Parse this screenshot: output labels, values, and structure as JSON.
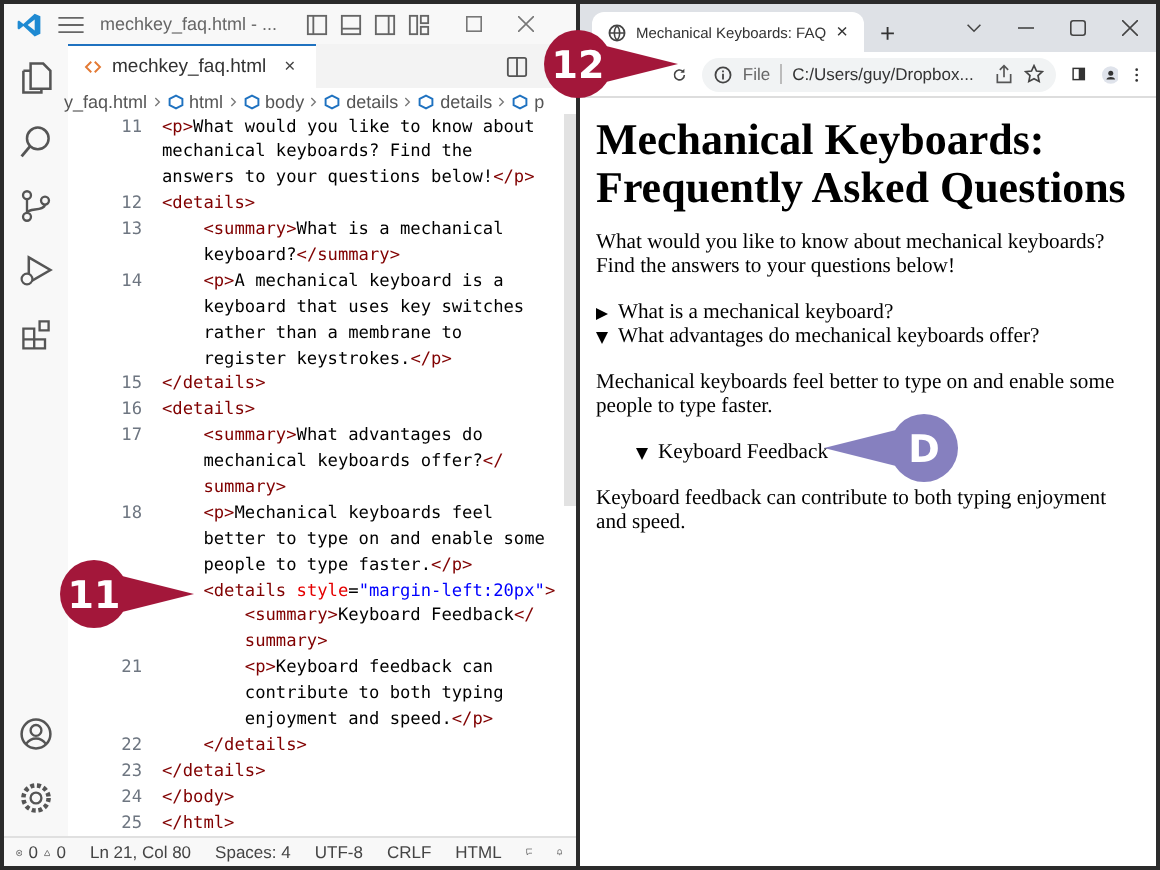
{
  "editor": {
    "title": "mechkey_faq.html - ...",
    "tab": {
      "label": "mechkey_faq.html",
      "close": "×"
    },
    "breadcrumbs": [
      "y_faq.html",
      "html",
      "body",
      "details",
      "details",
      "p"
    ],
    "rows": [
      {
        "number": "11",
        "segments": [
          {
            "kind": "tag",
            "text": "<p>"
          },
          {
            "kind": "text",
            "text": "What would you like to know about"
          }
        ]
      },
      {
        "segments": [
          {
            "kind": "text",
            "text": "mechanical keyboards? Find the"
          }
        ]
      },
      {
        "segments": [
          {
            "kind": "text",
            "text": "answers to your questions below!"
          },
          {
            "kind": "tag",
            "text": "</p>"
          }
        ]
      },
      {
        "number": "12",
        "segments": [
          {
            "kind": "tag",
            "text": "<details>"
          }
        ]
      },
      {
        "number": "13",
        "segments": [
          {
            "kind": "tag",
            "text": "    <summary>"
          },
          {
            "kind": "text",
            "text": "What is a mechanical"
          }
        ]
      },
      {
        "segments": [
          {
            "kind": "text",
            "text": "    keyboard?"
          },
          {
            "kind": "tag",
            "text": "</summary>"
          }
        ]
      },
      {
        "number": "14",
        "segments": [
          {
            "kind": "tag",
            "text": "    <p>"
          },
          {
            "kind": "text",
            "text": "A mechanical keyboard is a"
          }
        ]
      },
      {
        "segments": [
          {
            "kind": "text",
            "text": "    keyboard that uses key switches"
          }
        ]
      },
      {
        "segments": [
          {
            "kind": "text",
            "text": "    rather than a membrane to"
          }
        ]
      },
      {
        "segments": [
          {
            "kind": "text",
            "text": "    register keystrokes."
          },
          {
            "kind": "tag",
            "text": "</p>"
          }
        ]
      },
      {
        "number": "15",
        "segments": [
          {
            "kind": "tag",
            "text": "</details>"
          }
        ]
      },
      {
        "number": "16",
        "segments": [
          {
            "kind": "tag",
            "text": "<details>"
          }
        ]
      },
      {
        "number": "17",
        "segments": [
          {
            "kind": "tag",
            "text": "    <summary>"
          },
          {
            "kind": "text",
            "text": "What advantages do"
          }
        ]
      },
      {
        "segments": [
          {
            "kind": "text",
            "text": "    mechanical keyboards offer?"
          },
          {
            "kind": "tag",
            "text": "</"
          }
        ]
      },
      {
        "segments": [
          {
            "kind": "tag",
            "text": "    summary>"
          }
        ]
      },
      {
        "number": "18",
        "segments": [
          {
            "kind": "tag",
            "text": "    <p>"
          },
          {
            "kind": "text",
            "text": "Mechanical keyboards feel"
          }
        ]
      },
      {
        "segments": [
          {
            "kind": "text",
            "text": "    better to type on and enable some"
          }
        ]
      },
      {
        "segments": [
          {
            "kind": "text",
            "text": "    people to type faster."
          },
          {
            "kind": "tag",
            "text": "</p>"
          }
        ]
      },
      {
        "segments": [
          {
            "kind": "tag",
            "text": "    <details "
          },
          {
            "kind": "attr",
            "text": "style"
          },
          {
            "kind": "text",
            "text": "="
          },
          {
            "kind": "string",
            "text": "\"margin-left:20px\""
          },
          {
            "kind": "tag",
            "text": ">"
          }
        ]
      },
      {
        "segments": [
          {
            "kind": "tag",
            "text": "        <summary>"
          },
          {
            "kind": "text",
            "text": "Keyboard Feedback"
          },
          {
            "kind": "tag",
            "text": "</"
          }
        ]
      },
      {
        "segments": [
          {
            "kind": "tag",
            "text": "        summary>"
          }
        ]
      },
      {
        "number": "21",
        "segments": [
          {
            "kind": "tag",
            "text": "        <p>"
          },
          {
            "kind": "text",
            "text": "Keyboard feedback can"
          }
        ]
      },
      {
        "segments": [
          {
            "kind": "text",
            "text": "        contribute to both typing"
          }
        ]
      },
      {
        "segments": [
          {
            "kind": "text",
            "text": "        enjoyment and speed."
          },
          {
            "kind": "tag",
            "text": "</p>"
          }
        ]
      },
      {
        "number": "22",
        "segments": [
          {
            "kind": "tag",
            "text": "    </details>"
          }
        ]
      },
      {
        "number": "23",
        "segments": [
          {
            "kind": "tag",
            "text": "</details>"
          }
        ]
      },
      {
        "number": "24",
        "segments": [
          {
            "kind": "tag",
            "text": "</body>"
          }
        ]
      },
      {
        "number": "25",
        "segments": [
          {
            "kind": "tag",
            "text": "</html>"
          }
        ]
      }
    ],
    "status": {
      "errors": "0",
      "warnings": "0",
      "position": "Ln 21, Col 80",
      "spaces": "Spaces: 4",
      "encoding": "UTF-8",
      "eol": "CRLF",
      "language": "HTML"
    }
  },
  "browser": {
    "tab": {
      "title": "Mechanical Keyboards: FAQ",
      "close": "×"
    },
    "new_tab": "+",
    "address": {
      "scheme": "File",
      "url": "C:/Users/guy/Dropbox..."
    },
    "page": {
      "heading": "Mechanical Keyboards: Frequently Asked Questions",
      "intro": "What would you like to know about mechanical keyboards? Find the answers to your questions below!",
      "items": [
        {
          "summary": "What is a mechanical keyboard?",
          "expanded": false
        },
        {
          "summary": "What advantages do mechanical keyboards offer?",
          "expanded": true,
          "body": "Mechanical keyboards feel better to type on and enable some people to type faster.",
          "children": [
            {
              "summary": "Keyboard Feedback",
              "expanded": true,
              "body": "Keyboard feedback can contribute to both typing enjoyment and speed."
            }
          ]
        }
      ]
    }
  },
  "callouts": [
    {
      "label": "11",
      "color": "#a3173a"
    },
    {
      "label": "12",
      "color": "#a3173a"
    },
    {
      "label": "D",
      "color": "#8680bf"
    }
  ]
}
